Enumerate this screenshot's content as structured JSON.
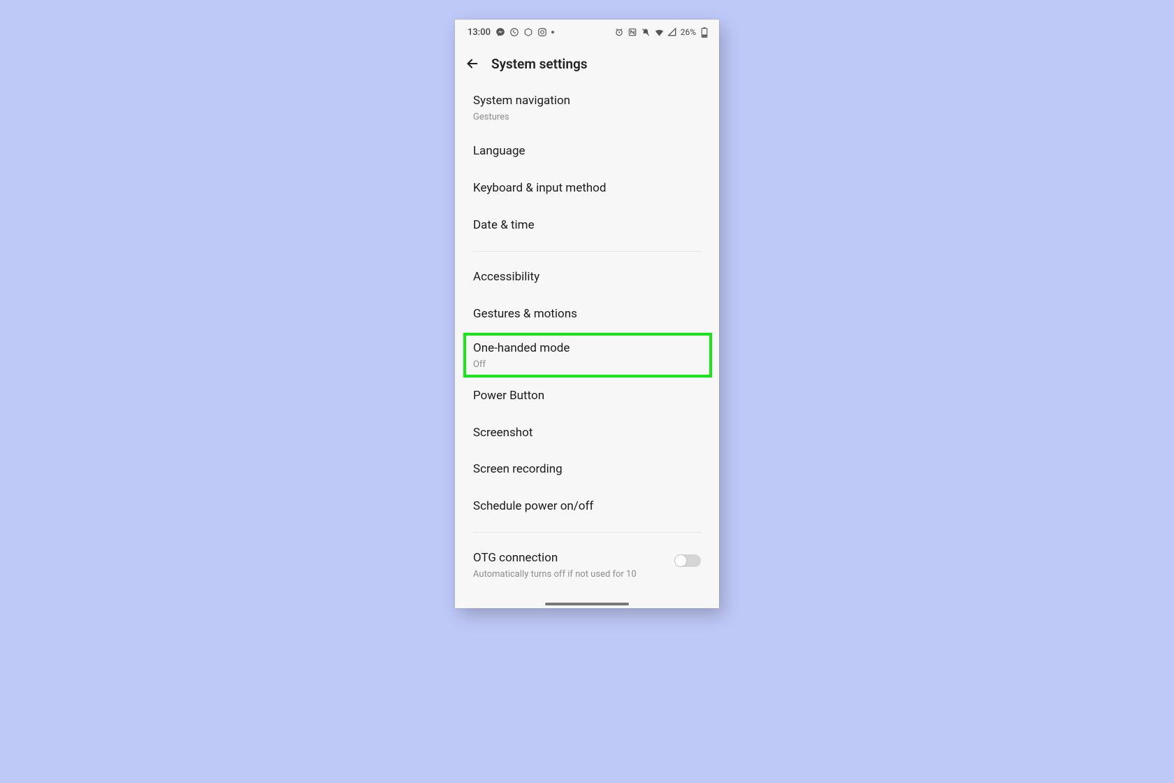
{
  "statusbar": {
    "time": "13:00",
    "battery_text": "26%",
    "left_icons": [
      "messenger",
      "whatsapp",
      "cube",
      "instagram",
      "dot"
    ],
    "right_icons": [
      "alarm",
      "nfc",
      "mute",
      "wifi",
      "signal",
      "battery"
    ]
  },
  "header": {
    "title": "System settings"
  },
  "items": {
    "sys_nav": {
      "title": "System navigation",
      "sub": "Gestures"
    },
    "language": {
      "title": "Language"
    },
    "keyboard": {
      "title": "Keyboard & input method"
    },
    "datetime": {
      "title": "Date & time"
    },
    "accessibility": {
      "title": "Accessibility"
    },
    "gestures": {
      "title": "Gestures & motions"
    },
    "onehand": {
      "title": "One-handed mode",
      "sub": "Off"
    },
    "power": {
      "title": "Power Button"
    },
    "screenshot": {
      "title": "Screenshot"
    },
    "screenrec": {
      "title": "Screen recording"
    },
    "schedule": {
      "title": "Schedule power on/off"
    },
    "otg": {
      "title": "OTG connection",
      "sub": "Automatically turns off if not used for 10"
    }
  }
}
